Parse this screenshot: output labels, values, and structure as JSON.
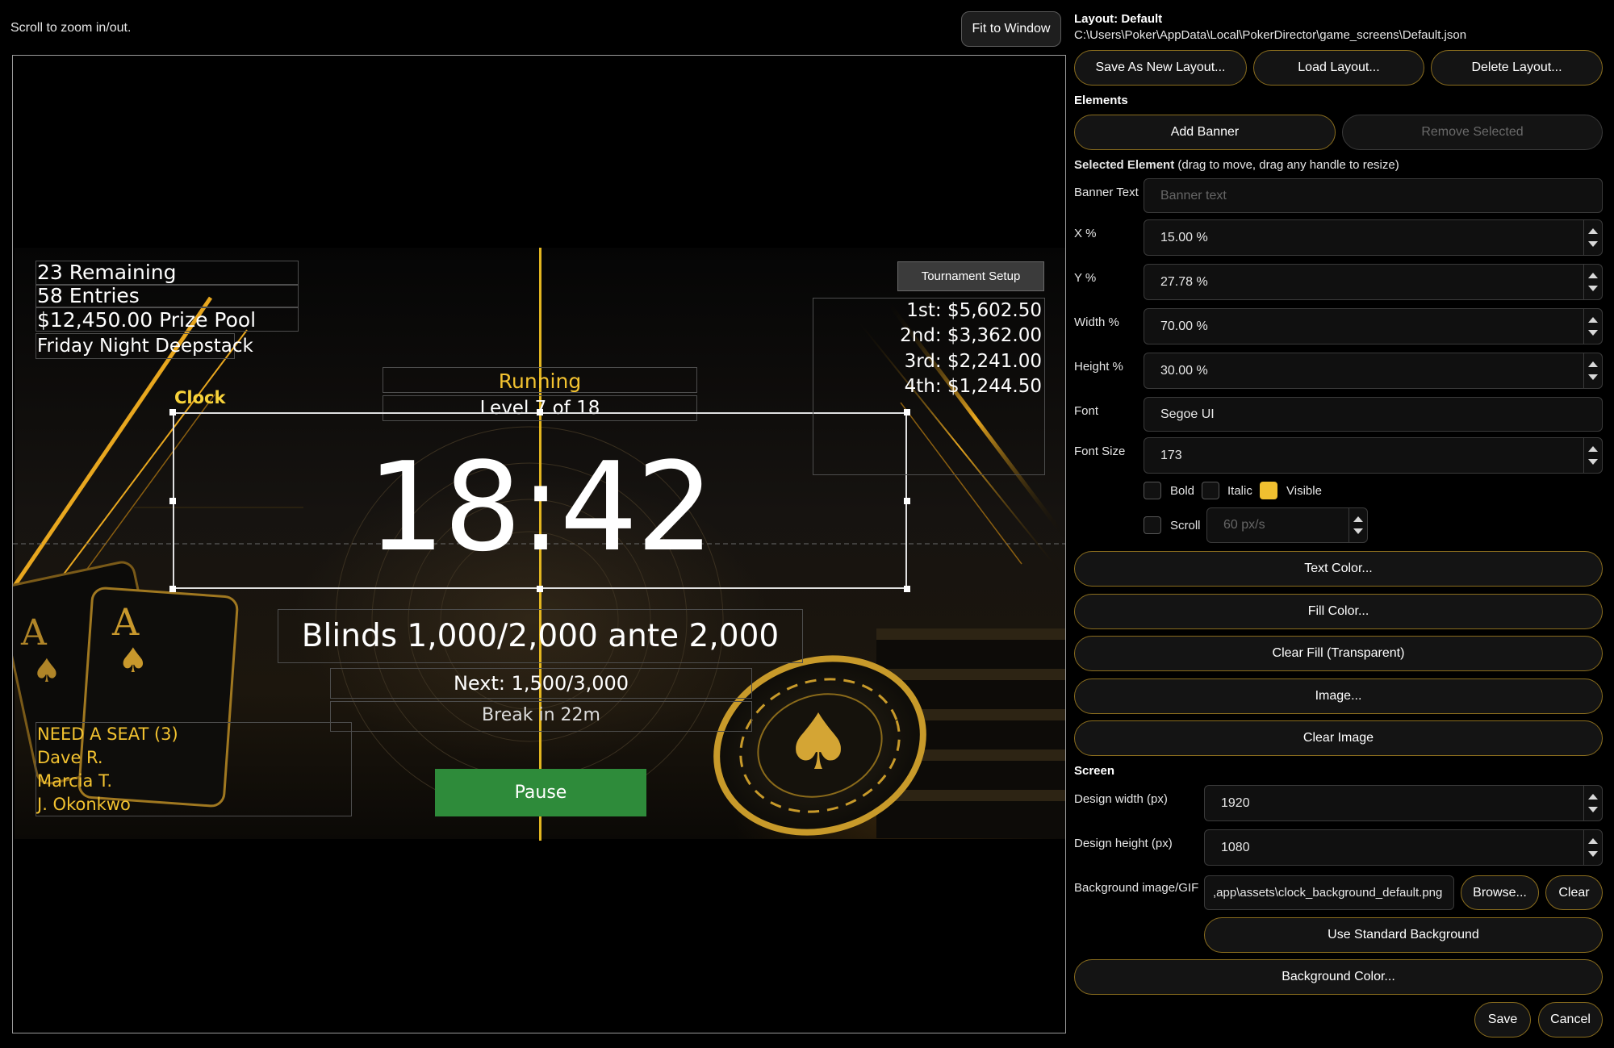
{
  "hint": "Scroll to zoom in/out.",
  "fit_button": "Fit to Window",
  "layout": {
    "title": "Layout: Default",
    "path": "C:\\Users\\Poker\\AppData\\Local\\PokerDirector\\game_screens\\Default.json",
    "save_as_new": "Save As New Layout...",
    "load": "Load Layout...",
    "delete": "Delete Layout..."
  },
  "elements": {
    "heading": "Elements",
    "add_banner": "Add Banner",
    "remove_selected": "Remove Selected"
  },
  "selected": {
    "heading": "Selected Element",
    "hint": " (drag to move, drag any handle to resize)",
    "banner_text_label": "Banner Text",
    "banner_text_placeholder": "Banner text",
    "x_label": "X %",
    "x_value": "15.00 %",
    "y_label": "Y %",
    "y_value": "27.78 %",
    "width_label": "Width %",
    "width_value": "70.00 %",
    "height_label": "Height %",
    "height_value": "30.00 %",
    "font_label": "Font",
    "font_value": "Segoe UI",
    "font_size_label": "Font Size",
    "font_size_value": "173",
    "bold": "Bold",
    "bold_checked": false,
    "italic": "Italic",
    "italic_checked": false,
    "visible": "Visible",
    "visible_checked": true,
    "scroll": "Scroll",
    "scroll_checked": false,
    "scroll_speed": "60 px/s",
    "text_color": "Text Color...",
    "fill_color": "Fill Color...",
    "clear_fill": "Clear Fill (Transparent)",
    "image": "Image...",
    "clear_image": "Clear Image"
  },
  "screen": {
    "heading": "Screen",
    "design_width_label": "Design width (px)",
    "design_width": "1920",
    "design_height_label": "Design height (px)",
    "design_height": "1080",
    "bg_label": "Background image/GIF",
    "bg_value": ",app\\assets\\clock_background_default.png",
    "browse": "Browse...",
    "clear": "Clear",
    "use_standard": "Use Standard Background",
    "bg_color": "Background Color..."
  },
  "footer": {
    "save": "Save",
    "cancel": "Cancel"
  },
  "preview": {
    "stats": [
      "23 Remaining",
      "58 Entries",
      "$12,450.00 Prize Pool"
    ],
    "event_name": "Friday Night Deepstack",
    "clock_label": "Clock",
    "status": "Running",
    "level": "Level 7 of 18",
    "time": "18:42",
    "blinds": "Blinds 1,000/2,000 ante 2,000",
    "next": "Next: 1,500/3,000",
    "break": "Break in 22m",
    "pause": "Pause",
    "tournament_setup": "Tournament Setup",
    "payouts": [
      "1st: $5,602.50",
      "2nd: $3,362.00",
      "3rd: $2,241.00",
      "4th: $1,244.50"
    ],
    "seat_heading": "NEED A SEAT (3)",
    "seat_names": [
      "Dave R.",
      "Marcia T.",
      "J. Okonkwo"
    ],
    "card_rank": "A",
    "spade": "♠"
  },
  "colors": {
    "accent": "#f2c230",
    "pause_green": "#2e8b3a",
    "button_border": "#8a6d1e"
  }
}
